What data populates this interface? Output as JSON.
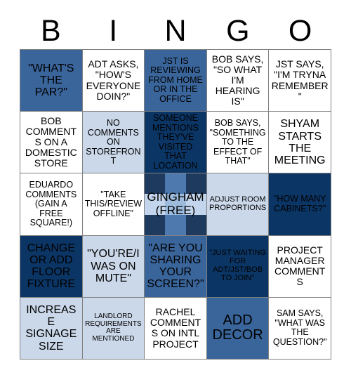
{
  "card": {
    "title": "BINGO",
    "header_letters": [
      "B",
      "I",
      "N",
      "G",
      "O"
    ],
    "colors": {
      "white": "#ffffff",
      "light_blue": "#cbd8e9",
      "medium_blue": "#3a659b",
      "dark_navy": "#0b3564",
      "gingham_dark": "#1f3a5f",
      "gingham_medium": "#4d79ae",
      "gingham_light": "#c3d5ec",
      "gingham_pale": "#9dbbdd",
      "grid_line": "#808080",
      "text": "#000000"
    },
    "rows": [
      [
        {
          "text": "\"WHAT'S THE PAR?\"",
          "fill": "medium",
          "size": "lg"
        },
        {
          "text": "ADT ASKS, \"HOW'S EVERYONE DOIN?\"",
          "fill": "white",
          "size": "md"
        },
        {
          "text": "JST IS REVIEWING FROM HOME OR IN THE OFFICE",
          "fill": "medium",
          "size": "sm"
        },
        {
          "text": "BOB SAYS, \"SO WHAT I'M HEARING IS\"",
          "fill": "white",
          "size": "md"
        },
        {
          "text": "JST SAYS, \"I'M TRYNA REMEMBER\"",
          "fill": "white",
          "size": "md"
        }
      ],
      [
        {
          "text": "BOB COMMENTS ON A DOMESTIC STORE",
          "fill": "white",
          "size": "md"
        },
        {
          "text": "NO COMMENTS ON STOREFRONT",
          "fill": "light",
          "size": "sm"
        },
        {
          "text": "SOMEONE MENTIONS THEY'VE VISITED THAT LOCATION",
          "fill": "dark",
          "size": "sm"
        },
        {
          "text": "BOB SAYS, \"SOMETHING TO THE EFFECT OF THAT\"",
          "fill": "white",
          "size": "sm"
        },
        {
          "text": "SHYAM STARTS THE MEETING",
          "fill": "white",
          "size": "lg"
        }
      ],
      [
        {
          "text": "EDUARDO COMMENTS (GAIN A FREE SQUARE!)",
          "fill": "white",
          "size": "sm"
        },
        {
          "text": "\"TAKE THIS/REVIEW OFFLINE\"",
          "fill": "white",
          "size": "sm"
        },
        {
          "text": "GINGHAM (FREE)",
          "fill": "gingham",
          "size": "lg",
          "free": true
        },
        {
          "text": "ADJUST ROOM PROPORTIONS",
          "fill": "light",
          "size": "xs"
        },
        {
          "text": "\"HOW MANY CABINETS?\"",
          "fill": "dark",
          "size": "sm"
        }
      ],
      [
        {
          "text": "CHANGE OR ADD FLOOR FIXTURE",
          "fill": "dark",
          "size": "lg"
        },
        {
          "text": "\"YOU'RE/I WAS ON MUTE\"",
          "fill": "light",
          "size": "lg"
        },
        {
          "text": "\"ARE YOU SHARING YOUR SCREEN?\"",
          "fill": "medium",
          "size": "lg"
        },
        {
          "text": "\"JUST WAITING FOR ADT/JST/BOB TO JOIN\"",
          "fill": "dark",
          "size": "xs"
        },
        {
          "text": "PROJECT MANAGER COMMENTS",
          "fill": "white",
          "size": "md"
        }
      ],
      [
        {
          "text": "INCREASE SIGNAGE SIZE",
          "fill": "light",
          "size": "lg"
        },
        {
          "text": "LANDLORD REQUIREMENTS ARE MENTIONED",
          "fill": "light",
          "size": "xxs"
        },
        {
          "text": "RACHEL COMMENTS ON INTL PROJECT",
          "fill": "white",
          "size": "md"
        },
        {
          "text": "ADD DECOR",
          "fill": "medium",
          "size": "xl"
        },
        {
          "text": "SAM SAYS, \"WHAT WAS THE QUESTION?\"",
          "fill": "white",
          "size": "sm"
        }
      ]
    ]
  }
}
